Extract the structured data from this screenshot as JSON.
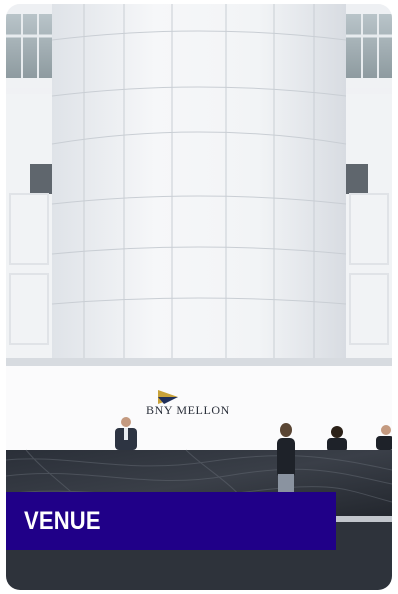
{
  "card": {
    "title": "VENUE"
  },
  "photo": {
    "sign_text": "BNY MELLON",
    "logo_icon": "bny-mellon-arrow-logo-icon"
  },
  "colors": {
    "banner": "#200088",
    "title_text": "#ffffff",
    "logo_gold": "#c8a23a",
    "logo_navy": "#1f2f5a"
  }
}
